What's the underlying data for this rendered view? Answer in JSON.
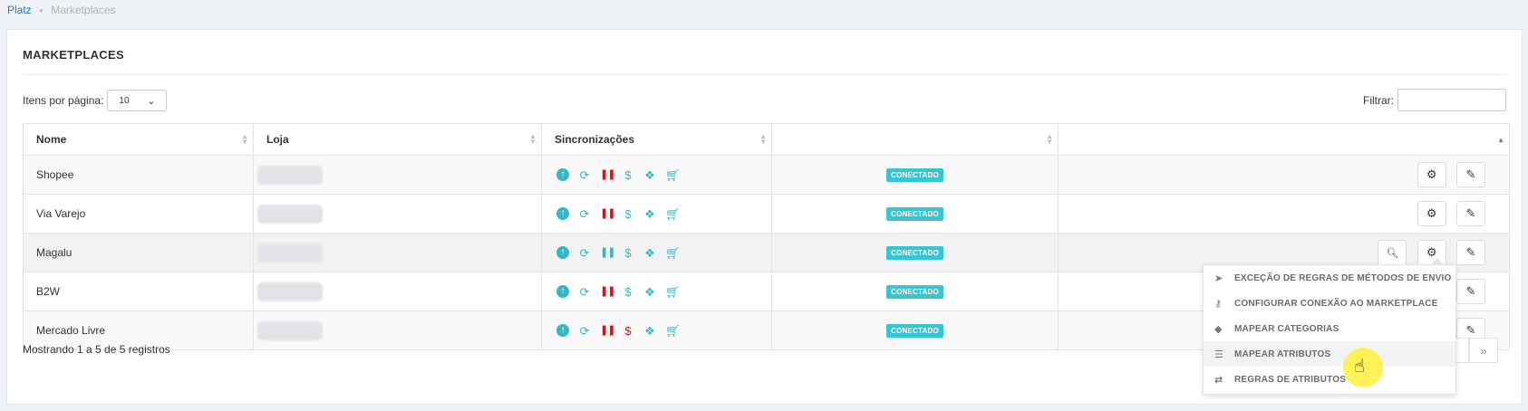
{
  "breadcrumb": {
    "root": "Platz",
    "current": "Marketplaces"
  },
  "panel": {
    "title": "MARKETPLACES"
  },
  "controls": {
    "perpage_label": "Itens por página:",
    "perpage_value": "10",
    "filter_label": "Filtrar:",
    "filter_value": ""
  },
  "table": {
    "headers": [
      "Nome",
      "Loja",
      "Sincronizações",
      "",
      ""
    ],
    "rows": [
      {
        "name": "Shopee",
        "status": "CONECTADO"
      },
      {
        "name": "Via Varejo",
        "status": "CONECTADO"
      },
      {
        "name": "Magalu",
        "status": "CONECTADO"
      },
      {
        "name": "B2W",
        "status": "CONECTADO"
      },
      {
        "name": "Mercado Livre",
        "status": "CONECTADO"
      }
    ]
  },
  "footer": {
    "info": "Mostrando 1 a 5 de 5 registros",
    "pager_next": "›",
    "pager_last": "»"
  },
  "dropdown": {
    "items": [
      {
        "label": "EXCEÇÃO DE REGRAS DE MÉTODOS DE ENVIO",
        "icon": "paper-plane-icon"
      },
      {
        "label": "CONFIGURAR CONEXÃO AO MARKETPLACE",
        "icon": "key-icon"
      },
      {
        "label": "MAPEAR CATEGORIAS",
        "icon": "tag-icon"
      },
      {
        "label": "MAPEAR ATRIBUTOS",
        "icon": "list-icon"
      },
      {
        "label": "REGRAS DE ATRIBUTOS",
        "icon": "exchange-icon"
      }
    ]
  },
  "colors": {
    "accent": "#36c6d3",
    "sync_teal": "#36b7c6",
    "sync_red": "#e01010",
    "link": "#337ab7"
  }
}
